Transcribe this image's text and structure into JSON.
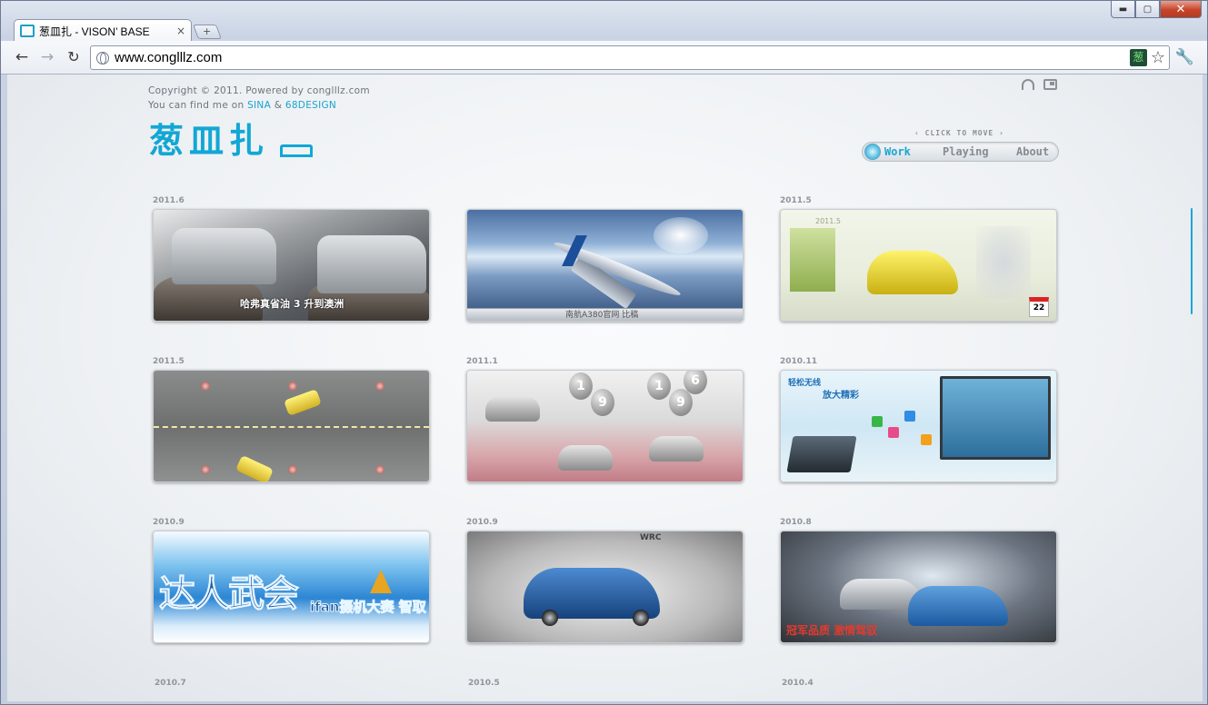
{
  "browser": {
    "tab_title": "葱皿扎 - VISON’ BASE",
    "tab_close": "×",
    "new_tab": "+",
    "url": "www.conglllz.com",
    "extension_badge": "葱",
    "window_controls": {
      "minimize": "▬",
      "maximize": "▢",
      "close": "✕"
    }
  },
  "header": {
    "copyright": "Copyright © 2011. Powered by conglllz.com",
    "find_me_prefix": "You can find me on",
    "sina": "SINA",
    "amp": "&",
    "design": "68DESIGN",
    "logo_text": "葱皿扎",
    "click_to_move": "‹ CLICK TO MOVE ›",
    "nav": {
      "work": "Work",
      "playing": "Playing",
      "about": "About"
    }
  },
  "works": [
    {
      "date": "2011.6",
      "caption": "哈弗真省油 3 升到澳洲"
    },
    {
      "date": "",
      "caption": "南航A380官网 比稿"
    },
    {
      "date": "2011.5",
      "caption": "2011.5",
      "badge": "22"
    },
    {
      "date": "2011.5",
      "caption": ""
    },
    {
      "date": "2011.1",
      "caption": ""
    },
    {
      "date": "2010.11",
      "caption_top": "轻松无线",
      "caption_sub": "放大精彩"
    },
    {
      "date": "2010.9",
      "caption": "达人武会",
      "caption_sub": "ifan摄机大赛 智取"
    },
    {
      "date": "2010.9",
      "caption": "WRC"
    },
    {
      "date": "2010.8",
      "caption": "冠军品质  激情驾驭"
    },
    {
      "date": "2010.7"
    },
    {
      "date": "2010.5"
    },
    {
      "date": "2010.4"
    }
  ],
  "colors": {
    "accent": "#1aa5d3"
  }
}
